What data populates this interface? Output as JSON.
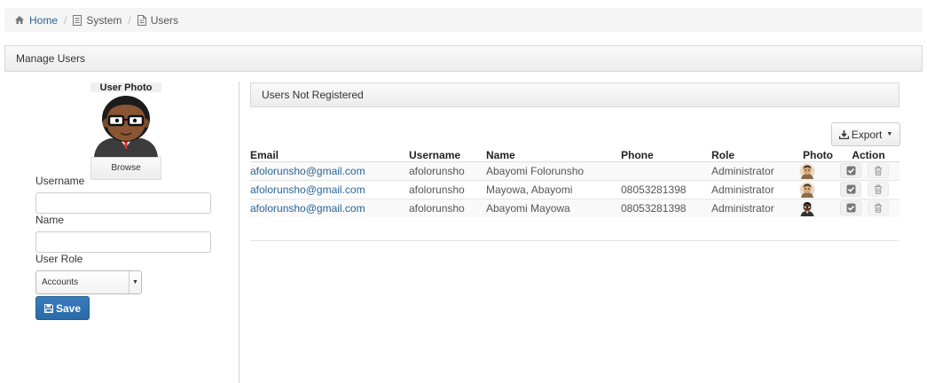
{
  "breadcrumb": {
    "home": "Home",
    "system": "System",
    "users": "Users"
  },
  "panel": {
    "title": "Manage Users"
  },
  "form": {
    "photo_title": "User Photo",
    "browse_label": "Browse",
    "username_label": "Username",
    "username_value": "",
    "name_label": "Name",
    "name_value": "",
    "role_label": "User Role",
    "role_selected": "Accounts",
    "save_label": "Save"
  },
  "users_panel": {
    "title": "Users Not Registered",
    "export_label": "Export",
    "columns": [
      "Email",
      "Username",
      "Name",
      "Phone",
      "Role",
      "Photo",
      "Action"
    ],
    "rows": [
      {
        "email": "afolorunsho@gmail.com",
        "username": "afolorunsho",
        "name": "Abayomi Folorunsho",
        "phone": "",
        "role": "Administrator",
        "photo": "cartoon-avatar"
      },
      {
        "email": "afolorunsho@gmail.com",
        "username": "afolorunsho",
        "name": "Mayowa, Abayomi",
        "phone": "08053281398",
        "role": "Administrator",
        "photo": "cartoon-avatar"
      },
      {
        "email": "afolorunsho@gmail.com",
        "username": "afolorunsho",
        "name": "Abayomi Mayowa",
        "phone": "08053281398",
        "role": "Administrator",
        "photo": "suit-avatar"
      }
    ]
  },
  "icons": {
    "home": "home-icon",
    "system": "document-icon",
    "users": "file-icon",
    "save": "floppy-disk-icon",
    "export": "download-icon",
    "approve": "checkbox-icon",
    "delete": "trash-icon"
  },
  "colors": {
    "link": "#2a6496",
    "primary": "#3071a9",
    "breadcrumb_bg": "#f5f5f5"
  }
}
